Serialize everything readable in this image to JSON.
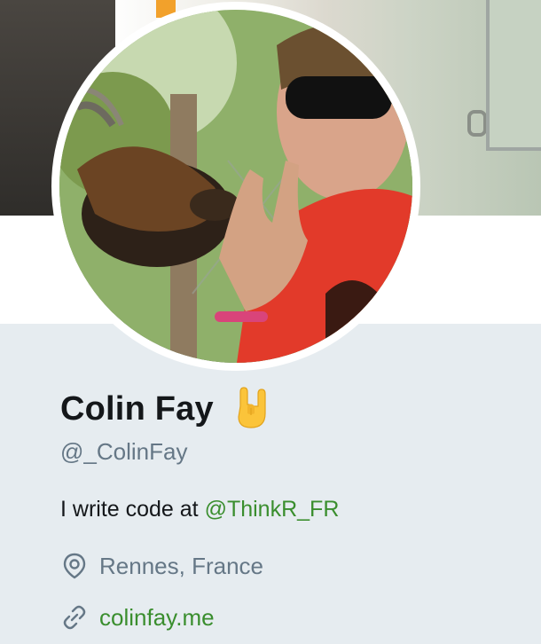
{
  "profile": {
    "name": "Colin Fay",
    "name_emoji": "🤘",
    "handle": "@_ColinFay",
    "bio_prefix": "I write code at ",
    "bio_mention": "@ThinkR_FR",
    "location": "Rennes, France",
    "website": "colinfay.me"
  },
  "icons": {
    "location": "location-pin-icon",
    "website": "link-icon",
    "emoji": "sign-of-the-horns-emoji"
  },
  "colors": {
    "link": "#3a8e2e",
    "secondary_text": "#657786",
    "primary_text": "#14171a",
    "background": "#e6ecf0"
  }
}
